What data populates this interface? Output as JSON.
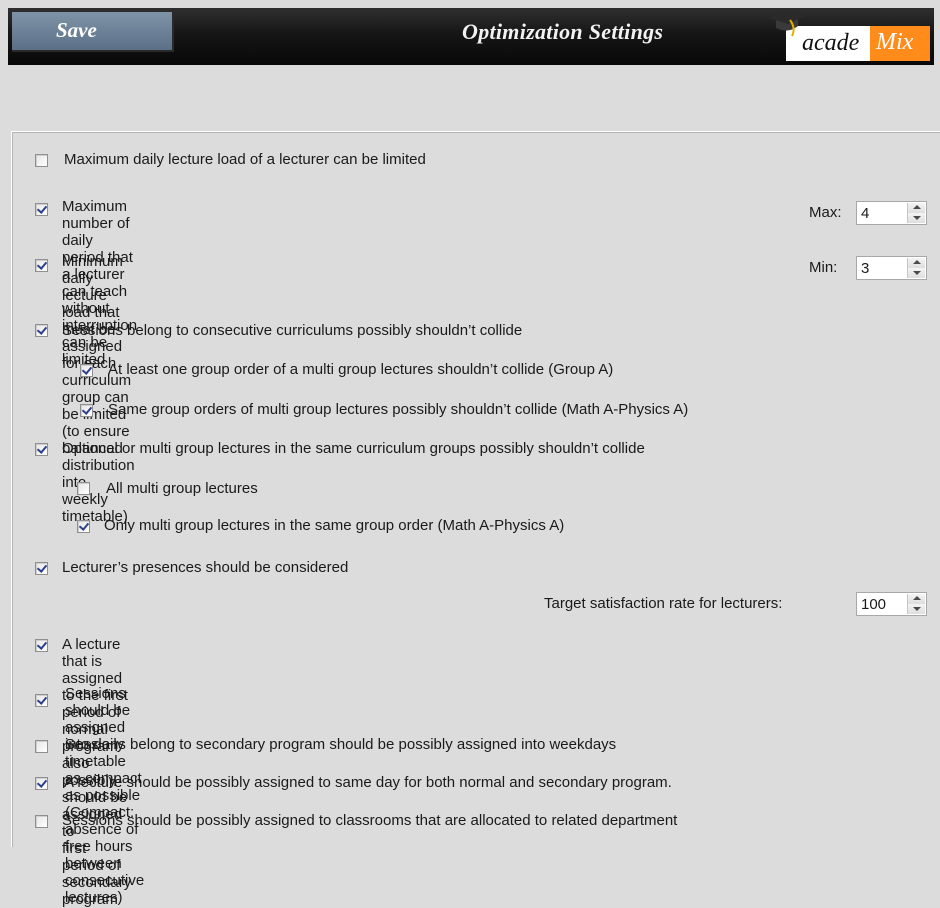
{
  "header": {
    "save_label": "Save",
    "title": "Optimization Settings",
    "logo": {
      "part1": "acade",
      "part2": "Mix",
      "accent": "#ff8c1a",
      "icon": "graduation-cap-icon"
    }
  },
  "options": [
    {
      "label": "Maximum daily lecture load of a lecturer can be limited",
      "checked": false
    },
    {
      "label": "Maximum number of daily period that a lecturer can teach without interruption\ncan be limited",
      "checked": true
    },
    {
      "label": "Minimum daily lecture load that must be assigned for each curriculum group can be limited\n(to ensure balanced distribution into weekly timetable)",
      "checked": true
    },
    {
      "label": "Sessions belong to consecutive curriculums possibly shouldn’t collide",
      "checked": true
    },
    {
      "label": "At least one group order of a multi group lectures shouldn’t collide (Group A)",
      "checked": true
    },
    {
      "label": "Same group orders of multi group lectures possibly shouldn’t collide (Math A-Physics A)",
      "checked": true
    },
    {
      "label": "Optional or multi group lectures in the same curriculum groups possibly shouldn’t collide",
      "checked": true
    },
    {
      "label": "All multi group lectures",
      "checked": false
    },
    {
      "label": "Only multi group lectures in the same group order (Math A-Physics A)",
      "checked": true
    },
    {
      "label": "Lecturer’s presences should be considered",
      "checked": true
    },
    {
      "label": "A lecture that is assigned to the first period of normal program also possibly should be assigned to\nfirst period of secondary program",
      "checked": true
    },
    {
      "label": "Sessions should be assigned into daily timetable as compact as possible\n(Compact: absence of free hours between consecutive lectures)",
      "checked": true
    },
    {
      "label": "Sessions belong to secondary program should be possibly assigned into weekdays",
      "checked": false
    },
    {
      "label": "A lecture should be possibly assigned to same day for both normal and secondary program.",
      "checked": true
    },
    {
      "label": "Sessions should be possibly assigned to classrooms that are allocated to related department",
      "checked": false
    }
  ],
  "spinners": {
    "max": {
      "label": "Max:",
      "value": "4"
    },
    "min": {
      "label": "Min:",
      "value": "3"
    },
    "target": {
      "label": "Target satisfaction rate for lecturers:",
      "value": "100"
    }
  }
}
